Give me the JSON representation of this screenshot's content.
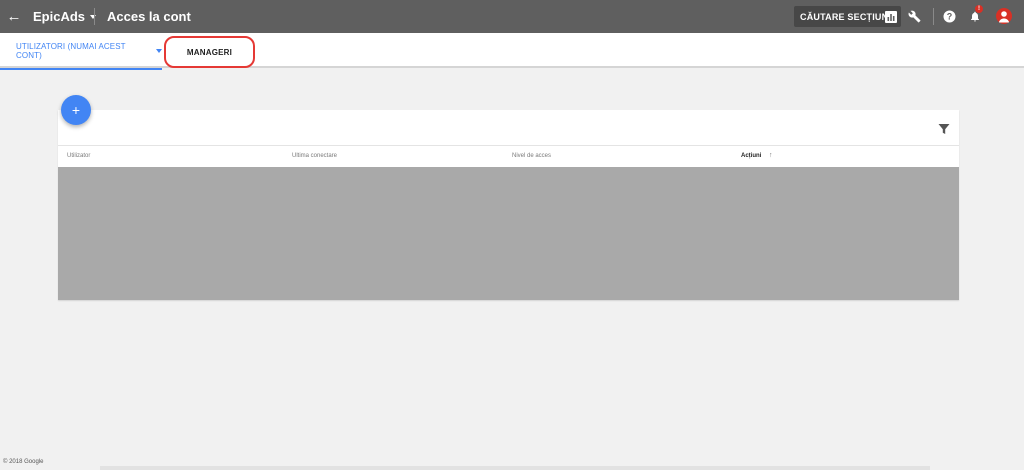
{
  "topbar": {
    "back_icon": "arrow-left-icon",
    "account_name": "EpicAds",
    "page_title": "Acces la cont",
    "search_label": "CĂUTARE SECȚIUNE",
    "icons": [
      "bar-chart-icon",
      "wrench-icon",
      "help-icon",
      "bell-icon",
      "account-avatar"
    ],
    "notification_badge": "!"
  },
  "tabs": {
    "users_label": "UTILIZATORI (NUMAI ACEST CONT)",
    "managers_label": "MANAGERI"
  },
  "table": {
    "columns": [
      "Utilizator",
      "Ultima conectare",
      "Nivel de acces",
      "Acțiuni"
    ],
    "sorted_column": "Acțiuni",
    "sort_icon": "↑"
  },
  "fab_label": "+",
  "footer": "© 2018 Google",
  "colors": {
    "topbar": "#5f5f5f",
    "accent": "#4285f4",
    "highlight": "#e53935",
    "table_body": "#a9a9a9"
  }
}
